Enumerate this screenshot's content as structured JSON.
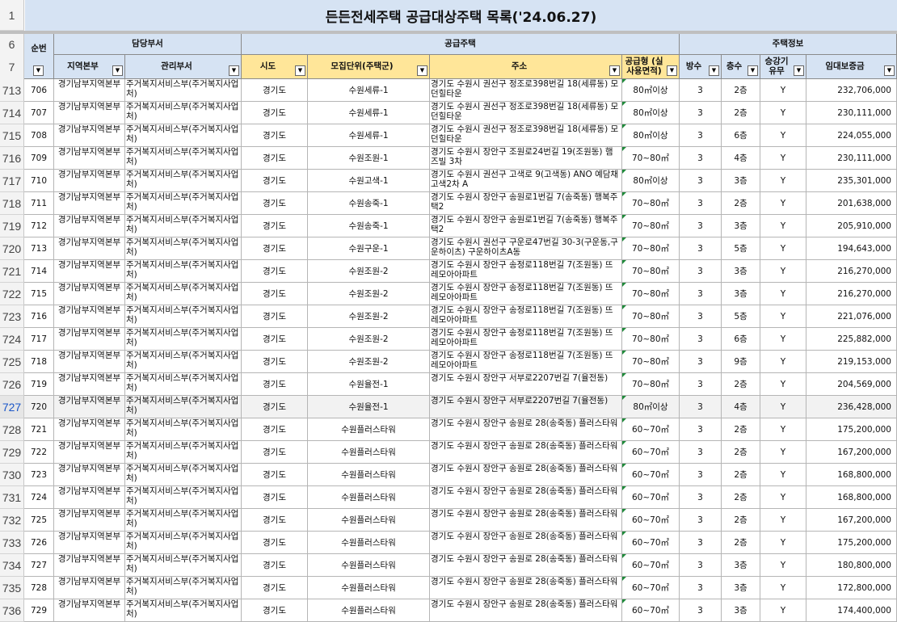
{
  "title_row": {
    "row_number": "1",
    "title": "든든전세주택 공급대상주택 목록('24.06.27)"
  },
  "header": {
    "row6_number": "6",
    "row7_number": "7",
    "group_dept": "담당부서",
    "group_supply": "공급주택",
    "group_info": "주택정보",
    "col_seq": "순번",
    "col_region": "지역본부",
    "col_office": "관리부서",
    "col_sido": "시도",
    "col_unit": "모집단위(주택군)",
    "col_address": "주소",
    "col_area": "공급형 (실사용면적)",
    "col_rooms": "방수",
    "col_floor": "층수",
    "col_elevator": "승강기 유무",
    "col_deposit": "임대보증금",
    "filter_glyph": "▼"
  },
  "active_row": "727",
  "rows": [
    {
      "rn": "713",
      "seq": "706",
      "region": "경기남부지역본부",
      "office": "주거복지서비스부(주거복지사업처)",
      "sido": "경기도",
      "unit": "수원세류-1",
      "address": "경기도 수원시 권선구 정조로398번길 18(세류동) 모던힐타운",
      "area": "80㎡이상",
      "rooms": "3",
      "floor": "2층",
      "elev": "Y",
      "deposit": "232,706,000"
    },
    {
      "rn": "714",
      "seq": "707",
      "region": "경기남부지역본부",
      "office": "주거복지서비스부(주거복지사업처)",
      "sido": "경기도",
      "unit": "수원세류-1",
      "address": "경기도 수원시 권선구 정조로398번길 18(세류동) 모던힐타운",
      "area": "80㎡이상",
      "rooms": "3",
      "floor": "2층",
      "elev": "Y",
      "deposit": "230,111,000"
    },
    {
      "rn": "715",
      "seq": "708",
      "region": "경기남부지역본부",
      "office": "주거복지서비스부(주거복지사업처)",
      "sido": "경기도",
      "unit": "수원세류-1",
      "address": "경기도 수원시 권선구 정조로398번길 18(세류동) 모던힐타운",
      "area": "80㎡이상",
      "rooms": "3",
      "floor": "6층",
      "elev": "Y",
      "deposit": "224,055,000"
    },
    {
      "rn": "716",
      "seq": "709",
      "region": "경기남부지역본부",
      "office": "주거복지서비스부(주거복지사업처)",
      "sido": "경기도",
      "unit": "수원조원-1",
      "address": "경기도 수원시 장안구 조원로24번길 19(조원동) 햄즈빌 3차",
      "area": "70~80㎡",
      "rooms": "3",
      "floor": "4층",
      "elev": "Y",
      "deposit": "230,111,000"
    },
    {
      "rn": "717",
      "seq": "710",
      "region": "경기남부지역본부",
      "office": "주거복지서비스부(주거복지사업처)",
      "sido": "경기도",
      "unit": "수원고색-1",
      "address": "경기도 수원시 권선구 고색로 9(고색동) ANO 예담채 고색2차 A",
      "area": "80㎡이상",
      "rooms": "3",
      "floor": "3층",
      "elev": "Y",
      "deposit": "235,301,000"
    },
    {
      "rn": "718",
      "seq": "711",
      "region": "경기남부지역본부",
      "office": "주거복지서비스부(주거복지사업처)",
      "sido": "경기도",
      "unit": "수원송죽-1",
      "address": "경기도 수원시 장안구 송원로1번길 7(송죽동) 행복주택2",
      "area": "70~80㎡",
      "rooms": "3",
      "floor": "2층",
      "elev": "Y",
      "deposit": "201,638,000"
    },
    {
      "rn": "719",
      "seq": "712",
      "region": "경기남부지역본부",
      "office": "주거복지서비스부(주거복지사업처)",
      "sido": "경기도",
      "unit": "수원송죽-1",
      "address": "경기도 수원시 장안구 송원로1번길 7(송죽동) 행복주택2",
      "area": "70~80㎡",
      "rooms": "3",
      "floor": "3층",
      "elev": "Y",
      "deposit": "205,910,000"
    },
    {
      "rn": "720",
      "seq": "713",
      "region": "경기남부지역본부",
      "office": "주거복지서비스부(주거복지사업처)",
      "sido": "경기도",
      "unit": "수원구운-1",
      "address": "경기도 수원시 권선구 구운로47번길 30-3(구운동,구운하이츠) 구운하이츠A동",
      "area": "70~80㎡",
      "rooms": "3",
      "floor": "5층",
      "elev": "Y",
      "deposit": "194,643,000"
    },
    {
      "rn": "721",
      "seq": "714",
      "region": "경기남부지역본부",
      "office": "주거복지서비스부(주거복지사업처)",
      "sido": "경기도",
      "unit": "수원조원-2",
      "address": "경기도 수원시 장안구 송정로118번길 7(조원동) 뜨레모아아파트",
      "area": "70~80㎡",
      "rooms": "3",
      "floor": "3층",
      "elev": "Y",
      "deposit": "216,270,000"
    },
    {
      "rn": "722",
      "seq": "715",
      "region": "경기남부지역본부",
      "office": "주거복지서비스부(주거복지사업처)",
      "sido": "경기도",
      "unit": "수원조원-2",
      "address": "경기도 수원시 장안구 송정로118번길 7(조원동) 뜨레모아아파트",
      "area": "70~80㎡",
      "rooms": "3",
      "floor": "3층",
      "elev": "Y",
      "deposit": "216,270,000"
    },
    {
      "rn": "723",
      "seq": "716",
      "region": "경기남부지역본부",
      "office": "주거복지서비스부(주거복지사업처)",
      "sido": "경기도",
      "unit": "수원조원-2",
      "address": "경기도 수원시 장안구 송정로118번길 7(조원동) 뜨레모아아파트",
      "area": "70~80㎡",
      "rooms": "3",
      "floor": "5층",
      "elev": "Y",
      "deposit": "221,076,000"
    },
    {
      "rn": "724",
      "seq": "717",
      "region": "경기남부지역본부",
      "office": "주거복지서비스부(주거복지사업처)",
      "sido": "경기도",
      "unit": "수원조원-2",
      "address": "경기도 수원시 장안구 송정로118번길 7(조원동) 뜨레모아아파트",
      "area": "70~80㎡",
      "rooms": "3",
      "floor": "6층",
      "elev": "Y",
      "deposit": "225,882,000"
    },
    {
      "rn": "725",
      "seq": "718",
      "region": "경기남부지역본부",
      "office": "주거복지서비스부(주거복지사업처)",
      "sido": "경기도",
      "unit": "수원조원-2",
      "address": "경기도 수원시 장안구 송정로118번길 7(조원동) 뜨레모아아파트",
      "area": "70~80㎡",
      "rooms": "3",
      "floor": "9층",
      "elev": "Y",
      "deposit": "219,153,000"
    },
    {
      "rn": "726",
      "seq": "719",
      "region": "경기남부지역본부",
      "office": "주거복지서비스부(주거복지사업처)",
      "sido": "경기도",
      "unit": "수원율전-1",
      "address": "경기도 수원시 장안구 서부로2207번길 7(율전동)",
      "area": "70~80㎡",
      "rooms": "3",
      "floor": "2층",
      "elev": "Y",
      "deposit": "204,569,000"
    },
    {
      "rn": "727",
      "seq": "720",
      "region": "경기남부지역본부",
      "office": "주거복지서비스부(주거복지사업처)",
      "sido": "경기도",
      "unit": "수원율전-1",
      "address": "경기도 수원시 장안구 서부로2207번길 7(율전동)",
      "area": "80㎡이상",
      "rooms": "3",
      "floor": "4층",
      "elev": "Y",
      "deposit": "236,428,000"
    },
    {
      "rn": "728",
      "seq": "721",
      "region": "경기남부지역본부",
      "office": "주거복지서비스부(주거복지사업처)",
      "sido": "경기도",
      "unit": "수원플러스타워",
      "address": "경기도 수원시 장안구 송원로 28(송죽동) 플러스타워",
      "area": "60~70㎡",
      "rooms": "3",
      "floor": "2층",
      "elev": "Y",
      "deposit": "175,200,000"
    },
    {
      "rn": "729",
      "seq": "722",
      "region": "경기남부지역본부",
      "office": "주거복지서비스부(주거복지사업처)",
      "sido": "경기도",
      "unit": "수원플러스타워",
      "address": "경기도 수원시 장안구 송원로 28(송죽동) 플러스타워",
      "area": "60~70㎡",
      "rooms": "3",
      "floor": "2층",
      "elev": "Y",
      "deposit": "167,200,000"
    },
    {
      "rn": "730",
      "seq": "723",
      "region": "경기남부지역본부",
      "office": "주거복지서비스부(주거복지사업처)",
      "sido": "경기도",
      "unit": "수원플러스타워",
      "address": "경기도 수원시 장안구 송원로 28(송죽동) 플러스타워",
      "area": "60~70㎡",
      "rooms": "3",
      "floor": "2층",
      "elev": "Y",
      "deposit": "168,800,000"
    },
    {
      "rn": "731",
      "seq": "724",
      "region": "경기남부지역본부",
      "office": "주거복지서비스부(주거복지사업처)",
      "sido": "경기도",
      "unit": "수원플러스타워",
      "address": "경기도 수원시 장안구 송원로 28(송죽동) 플러스타워",
      "area": "60~70㎡",
      "rooms": "3",
      "floor": "2층",
      "elev": "Y",
      "deposit": "168,800,000"
    },
    {
      "rn": "732",
      "seq": "725",
      "region": "경기남부지역본부",
      "office": "주거복지서비스부(주거복지사업처)",
      "sido": "경기도",
      "unit": "수원플러스타워",
      "address": "경기도 수원시 장안구 송원로 28(송죽동) 플러스타워",
      "area": "60~70㎡",
      "rooms": "3",
      "floor": "2층",
      "elev": "Y",
      "deposit": "167,200,000"
    },
    {
      "rn": "733",
      "seq": "726",
      "region": "경기남부지역본부",
      "office": "주거복지서비스부(주거복지사업처)",
      "sido": "경기도",
      "unit": "수원플러스타워",
      "address": "경기도 수원시 장안구 송원로 28(송죽동) 플러스타워",
      "area": "60~70㎡",
      "rooms": "3",
      "floor": "2층",
      "elev": "Y",
      "deposit": "175,200,000"
    },
    {
      "rn": "734",
      "seq": "727",
      "region": "경기남부지역본부",
      "office": "주거복지서비스부(주거복지사업처)",
      "sido": "경기도",
      "unit": "수원플러스타워",
      "address": "경기도 수원시 장안구 송원로 28(송죽동) 플러스타워",
      "area": "60~70㎡",
      "rooms": "3",
      "floor": "3층",
      "elev": "Y",
      "deposit": "180,800,000"
    },
    {
      "rn": "735",
      "seq": "728",
      "region": "경기남부지역본부",
      "office": "주거복지서비스부(주거복지사업처)",
      "sido": "경기도",
      "unit": "수원플러스타워",
      "address": "경기도 수원시 장안구 송원로 28(송죽동) 플러스타워",
      "area": "60~70㎡",
      "rooms": "3",
      "floor": "3층",
      "elev": "Y",
      "deposit": "172,800,000"
    },
    {
      "rn": "736",
      "seq": "729",
      "region": "경기남부지역본부",
      "office": "주거복지서비스부(주거복지사업처)",
      "sido": "경기도",
      "unit": "수원플러스타워",
      "address": "경기도 수원시 장안구 송원로 28(송죽동) 플러스타워",
      "area": "60~70㎡",
      "rooms": "3",
      "floor": "3층",
      "elev": "Y",
      "deposit": "174,400,000"
    }
  ]
}
